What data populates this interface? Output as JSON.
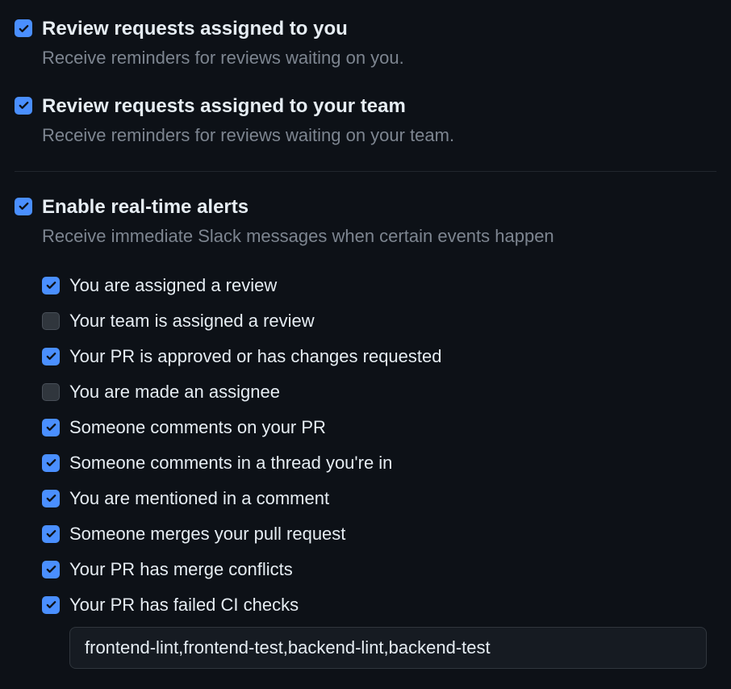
{
  "options": {
    "review_you": {
      "title": "Review requests assigned to you",
      "description": "Receive reminders for reviews waiting on you.",
      "checked": true
    },
    "review_team": {
      "title": "Review requests assigned to your team",
      "description": "Receive reminders for reviews waiting on your team.",
      "checked": true
    },
    "realtime": {
      "title": "Enable real-time alerts",
      "description": "Receive immediate Slack messages when certain events happen",
      "checked": true
    }
  },
  "alerts": [
    {
      "label": "You are assigned a review",
      "checked": true
    },
    {
      "label": "Your team is assigned a review",
      "checked": false
    },
    {
      "label": "Your PR is approved or has changes requested",
      "checked": true
    },
    {
      "label": "You are made an assignee",
      "checked": false
    },
    {
      "label": "Someone comments on your PR",
      "checked": true
    },
    {
      "label": "Someone comments in a thread you're in",
      "checked": true
    },
    {
      "label": "You are mentioned in a comment",
      "checked": true
    },
    {
      "label": "Someone merges your pull request",
      "checked": true
    },
    {
      "label": "Your PR has merge conflicts",
      "checked": true
    },
    {
      "label": "Your PR has failed CI checks",
      "checked": true
    }
  ],
  "ci_checks_value": "frontend-lint,frontend-test,backend-lint,backend-test"
}
